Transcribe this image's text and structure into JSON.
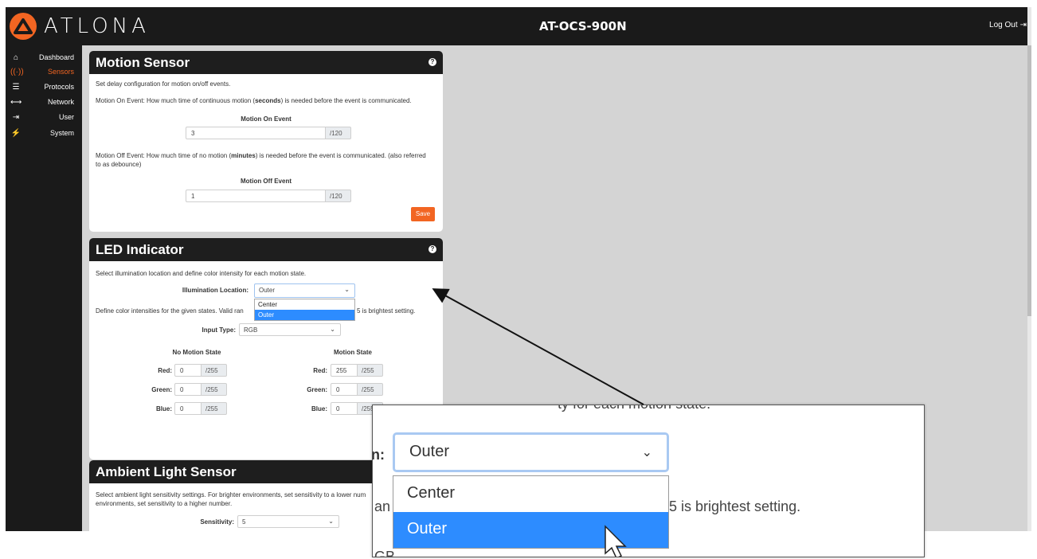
{
  "header": {
    "brand": "ATLONA",
    "device_name": "AT-OCS-900N",
    "logout_label": "Log Out"
  },
  "sidebar": {
    "items": [
      {
        "label": "Dashboard",
        "icon": "home-icon",
        "active": false
      },
      {
        "label": "Sensors",
        "icon": "sensor-icon",
        "active": true
      },
      {
        "label": "Protocols",
        "icon": "server-icon",
        "active": false
      },
      {
        "label": "Network",
        "icon": "network-arrows-icon",
        "active": false
      },
      {
        "label": "User",
        "icon": "sign-in-icon",
        "active": false
      },
      {
        "label": "System",
        "icon": "plug-icon",
        "active": false
      }
    ]
  },
  "motion_sensor": {
    "title": "Motion Sensor",
    "intro": "Set delay configuration for motion on/off events.",
    "on_desc_pre": "Motion On Event: How much time of continuous motion (",
    "on_desc_bold": "seconds",
    "on_desc_post": ") is needed before the event is communicated.",
    "on_label": "Motion On Event",
    "on_value": "3",
    "on_max": "/120",
    "off_desc_pre": "Motion Off Event: How much time of no motion (",
    "off_desc_bold": "minutes",
    "off_desc_post": ") is needed before the event is communicated. (also referred to as debounce)",
    "off_label": "Motion Off Event",
    "off_value": "1",
    "off_max": "/120",
    "save_label": "Save"
  },
  "led_indicator": {
    "title": "LED Indicator",
    "intro": "Select illumination location and define color intensity for each motion state.",
    "location_label": "Illumination Location:",
    "location_value": "Outer",
    "location_options": [
      "Center",
      "Outer"
    ],
    "define_text_pre": "Define color intensities for the given states. Valid ran",
    "define_text_post": "5 is brightest setting.",
    "input_type_label": "Input Type:",
    "input_type_value": "RGB",
    "no_motion_title": "No Motion State",
    "motion_title": "Motion State",
    "red_label": "Red:",
    "green_label": "Green:",
    "blue_label": "Blue:",
    "max_suffix": "/255",
    "no_motion": {
      "red": "0",
      "green": "0",
      "blue": "0"
    },
    "motion": {
      "red": "255",
      "green": "0",
      "blue": "0"
    }
  },
  "ambient": {
    "title": "Ambient Light Sensor",
    "desc": "Select ambient light sensitivity settings. For brighter environments, set sensitivity to a lower num",
    "desc2": "environments, set sensitivity to a higher number.",
    "sensitivity_label": "Sensitivity:",
    "sensitivity_value": "5"
  },
  "zoom": {
    "top_text": "ty for each motion state.",
    "label_tail": "n:",
    "selected": "Outer",
    "options": [
      "Center",
      "Outer"
    ],
    "left_fragment": "an",
    "right_fragment": "5 is brightest setting.",
    "bottom_fragment": "GB"
  },
  "colors": {
    "accent": "#f26522",
    "selection": "#2d8cff",
    "header": "#1a1a1a"
  }
}
